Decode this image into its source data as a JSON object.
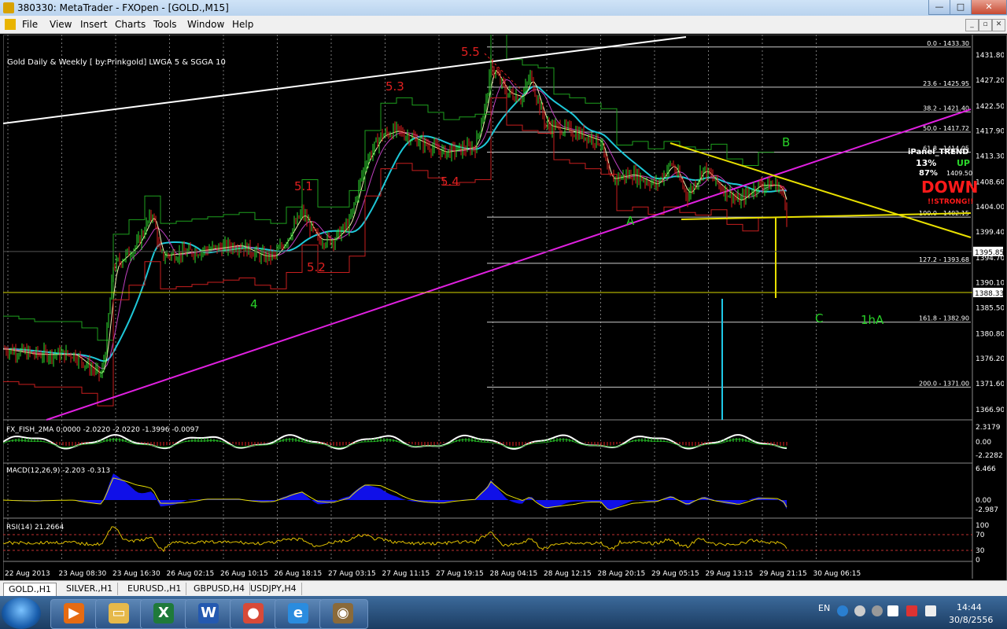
{
  "window": {
    "title": "380330: MetaTrader - FXOpen - [GOLD.,M15]",
    "min_glyph": "—",
    "max_glyph": "□",
    "close_glyph": "✕"
  },
  "menu": [
    "File",
    "View",
    "Insert",
    "Charts",
    "Tools",
    "Window",
    "Help"
  ],
  "mdi": {
    "min": "_",
    "restore": "▫",
    "close": "✕"
  },
  "chart": {
    "indicator_label": "Gold Daily & Weekly [ by:Prinkgold] LWGA 5 & SGGA 10",
    "price_labels": [
      "1431.80",
      "1427.20",
      "1422.50",
      "1417.90",
      "1413.30",
      "1408.60",
      "1404.00",
      "1399.40",
      "1394.70",
      "1390.10",
      "1385.50",
      "1380.80",
      "1376.20",
      "1371.60",
      "1366.90"
    ],
    "price_values": [
      1431.8,
      1427.2,
      1422.5,
      1417.9,
      1413.3,
      1408.6,
      1404.0,
      1399.4,
      1394.7,
      1390.1,
      1385.5,
      1380.8,
      1376.2,
      1371.6,
      1366.9
    ],
    "current_price": "1395.85",
    "yellow_level": "1388.33",
    "fib_levels": [
      {
        "label": "0.0 - 1433.30",
        "price": 1433.3
      },
      {
        "label": "23.6 - 1425.95",
        "price": 1425.95
      },
      {
        "label": "38.2 - 1421.40",
        "price": 1421.4
      },
      {
        "label": "50.0 - 1417.72",
        "price": 1417.72
      },
      {
        "label": "61.8 - 1414.05",
        "price": 1414.05
      },
      {
        "label": "100.0 - 1402.15",
        "price": 1402.15
      },
      {
        "label": "127.2 - 1393.68",
        "price": 1393.68
      },
      {
        "label": "161.8 - 1382.90",
        "price": 1382.9
      },
      {
        "label": "200.0 - 1371.00",
        "price": 1371.0
      }
    ],
    "wave_labels": [
      {
        "text": "5.5",
        "color": "#e02020"
      },
      {
        "text": "5.3",
        "color": "#e02020"
      },
      {
        "text": "5.1",
        "color": "#e02020"
      },
      {
        "text": "5.4",
        "color": "#e02020"
      },
      {
        "text": "5.2",
        "color": "#e02020"
      },
      {
        "text": "4",
        "color": "#28d228"
      },
      {
        "text": "B",
        "color": "#28d228"
      },
      {
        "text": "A",
        "color": "#28d228"
      },
      {
        "text": "C",
        "color": "#28d228"
      },
      {
        "text": "1hA",
        "color": "#28d228"
      }
    ],
    "ipanel": {
      "title": "iPanel_TREND",
      "pct1": "13%",
      "dir1": "UP",
      "pct2": "87%",
      "overlap_price": "1409.50",
      "signal": "DOWN",
      "strength": "!!STRONG!!"
    },
    "time_labels": [
      "22 Aug 2013",
      "23 Aug 08:30",
      "23 Aug 16:30",
      "26 Aug 02:15",
      "26 Aug 10:15",
      "26 Aug 18:15",
      "27 Aug 03:15",
      "27 Aug 11:15",
      "27 Aug 19:15",
      "28 Aug 04:15",
      "28 Aug 12:15",
      "28 Aug 20:15",
      "29 Aug 05:15",
      "29 Aug 13:15",
      "29 Aug 21:15",
      "30 Aug 06:15"
    ]
  },
  "subwindows": {
    "fisher": {
      "label": "FX_FISH_2MA 0.0000 -2.0220 -2.0220 -1.3996 -0.0097",
      "scale": [
        "2.3179",
        "0.00",
        "-2.2282"
      ]
    },
    "macd": {
      "label": "MACD(12,26,9) -2.203 -0.313",
      "scale": [
        "6.466",
        "0.00",
        "-2.987"
      ]
    },
    "rsi": {
      "label": "RSI(14) 21.2664",
      "scale": [
        "100",
        "70",
        "30",
        "0"
      ]
    }
  },
  "tabs": [
    "GOLD.,H1",
    "SILVER.,H1",
    "EURUSD.,H1",
    "GBPUSD,H4",
    "USDJPY,H4"
  ],
  "taskbar": {
    "apps": [
      {
        "name": "media-player-icon",
        "glyph": "▶",
        "color": "#e66b12"
      },
      {
        "name": "folder-icon",
        "glyph": "▭",
        "color": "#e6b94a"
      },
      {
        "name": "excel-icon",
        "glyph": "X",
        "color": "#1f7a3a"
      },
      {
        "name": "word-icon",
        "glyph": "W",
        "color": "#2459b0"
      },
      {
        "name": "chrome-icon",
        "glyph": "●",
        "color": "#d84a38"
      },
      {
        "name": "ie-icon",
        "glyph": "e",
        "color": "#2a8cdf"
      },
      {
        "name": "metatrader-icon",
        "glyph": "◉",
        "color": "#8a6a3a"
      }
    ],
    "lang": "EN",
    "time": "14:44",
    "date": "30/8/2556"
  }
}
